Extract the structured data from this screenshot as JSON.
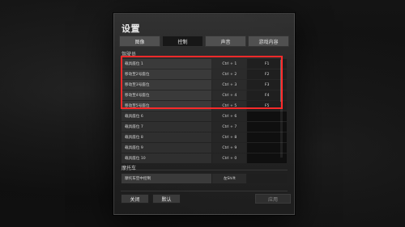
{
  "window": {
    "title": "设置"
  },
  "tabs": [
    {
      "label": "图像",
      "active": false
    },
    {
      "label": "控制",
      "active": true
    },
    {
      "label": "声音",
      "active": false
    },
    {
      "label": "游戏内容",
      "active": false
    }
  ],
  "sections": {
    "section1_label": "驾驶员",
    "section2_label": "摩托车"
  },
  "keybind_rows": [
    {
      "name": "载具座位 1",
      "key1": "Ctrl + 1",
      "key2": "F1"
    },
    {
      "name": "移动至2号座位",
      "key1": "Ctrl + 2",
      "key2": "F2"
    },
    {
      "name": "移动至3号座位",
      "key1": "Ctrl + 3",
      "key2": "F3"
    },
    {
      "name": "移动至4号座位",
      "key1": "Ctrl + 4",
      "key2": "F4"
    },
    {
      "name": "移动至5号座位",
      "key1": "Ctrl + 5",
      "key2": "F5"
    },
    {
      "name": "载具座位 6",
      "key1": "Ctrl + 6",
      "key2": ""
    },
    {
      "name": "载具座位 7",
      "key1": "Ctrl + 7",
      "key2": ""
    },
    {
      "name": "载具座位 8",
      "key1": "Ctrl + 8",
      "key2": ""
    },
    {
      "name": "载具座位 9",
      "key1": "Ctrl + 9",
      "key2": ""
    },
    {
      "name": "载具座位 10",
      "key1": "Ctrl + 0",
      "key2": ""
    }
  ],
  "motorcycle_rows": [
    {
      "name": "摩托车空中控制",
      "key1": "左Shift",
      "key2": ""
    }
  ],
  "buttons": {
    "close": "关闭",
    "default": "默认",
    "apply": "应用"
  },
  "colors": {
    "highlight": "#ff2a2a",
    "active_tab": "#171717",
    "inactive_tab": "#505050"
  }
}
